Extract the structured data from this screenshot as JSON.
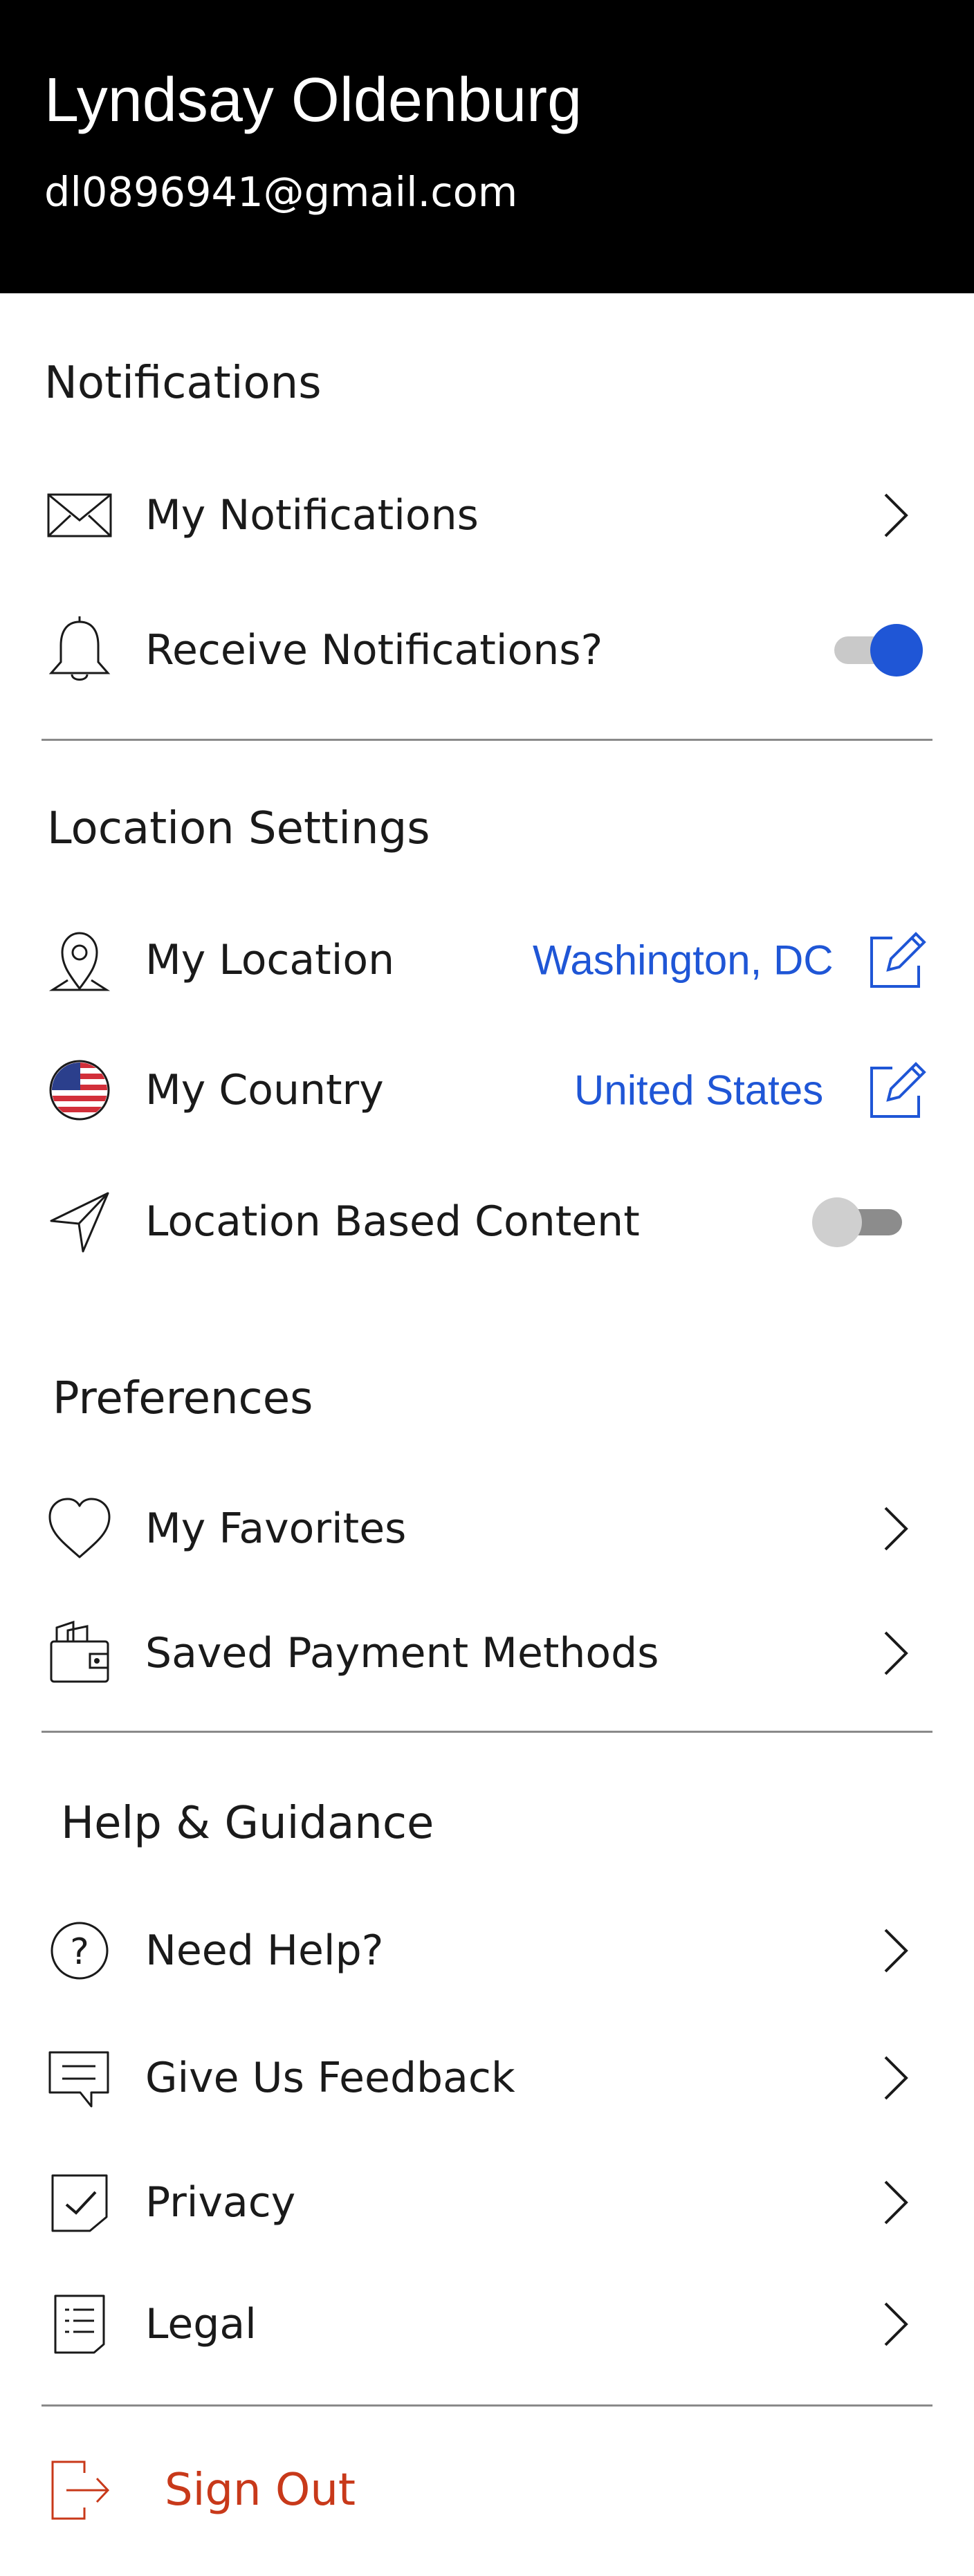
{
  "profile": {
    "name": "Lyndsay Oldenburg",
    "email": "dl0896941@gmail.com"
  },
  "sections": {
    "notifications": "Notifications",
    "location": "Location Settings",
    "preferences": "Preferences",
    "help": "Help & Guidance"
  },
  "items": {
    "my_notifications": "My Notifications",
    "receive_notifications": "Receive Notifications?",
    "my_location": "My Location",
    "my_location_value": "Washington, DC",
    "my_country": "My Country",
    "my_country_value": "United States",
    "location_based_content": "Location Based Content",
    "my_favorites": "My Favorites",
    "saved_payment_methods": "Saved Payment Methods",
    "need_help": "Need Help?",
    "give_feedback": "Give Us Feedback",
    "privacy": "Privacy",
    "legal": "Legal",
    "sign_out": "Sign Out"
  },
  "toggles": {
    "receive_notifications": true,
    "location_based_content": false
  },
  "icons": {
    "my_notifications": "envelope-icon",
    "receive_notifications": "bell-icon",
    "my_location": "map-pin-icon",
    "my_country": "us-flag-icon",
    "location_based_content": "navigation-arrow-icon",
    "my_favorites": "heart-icon",
    "saved_payment_methods": "wallet-icon",
    "need_help": "question-icon",
    "give_feedback": "chat-icon",
    "privacy": "shield-check-icon",
    "legal": "document-list-icon",
    "sign_out": "sign-out-icon"
  },
  "colors": {
    "header_bg": "#000000",
    "link_blue": "#1f56d6",
    "toggle_on": "#1f56d6",
    "sign_out_red": "#c8391a",
    "divider": "#8a8a8a"
  }
}
